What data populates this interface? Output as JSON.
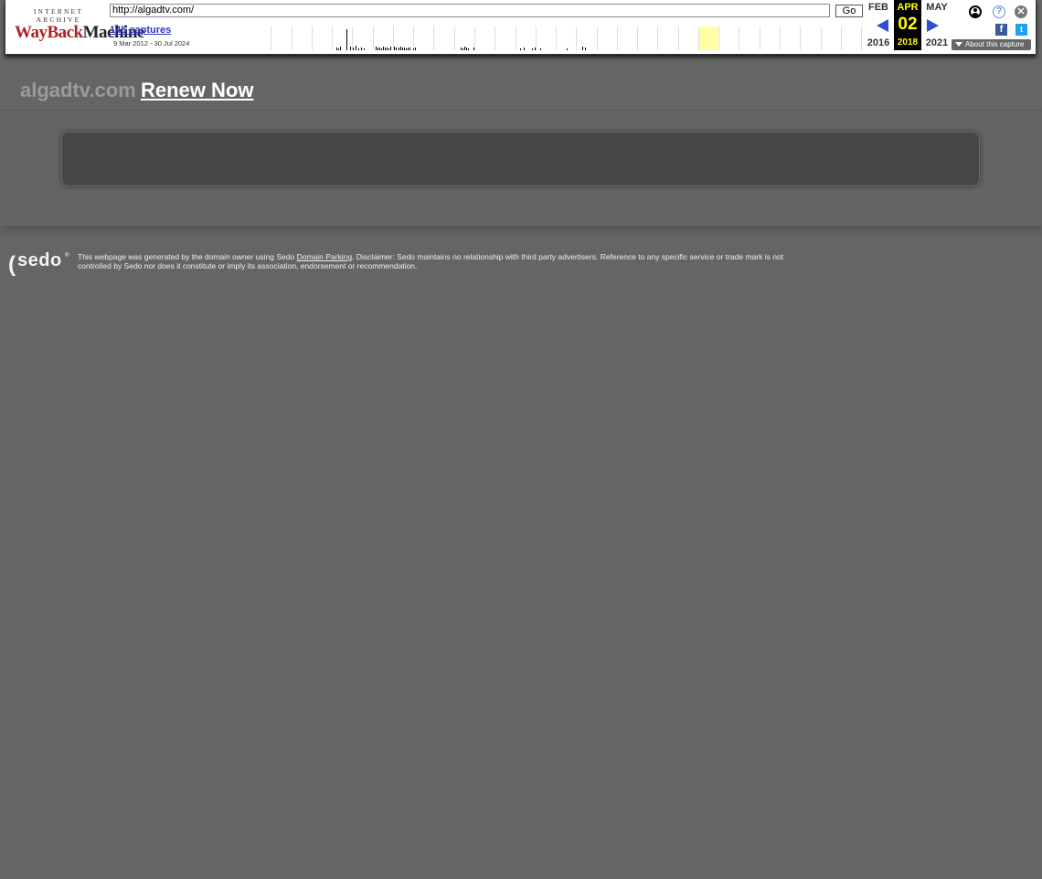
{
  "wayback": {
    "logo_top": "INTERNET ARCHIVE",
    "logo_wayback": "WayBack",
    "logo_machine": "Machine",
    "url_value": "http://algadtv.com/",
    "go_label": "Go",
    "captures_label": "145 captures",
    "range_label": "9 Mar 2012 - 30 Jul 2024",
    "prev": {
      "month": "FEB",
      "year": "2016"
    },
    "current": {
      "month": "APR",
      "day": "02",
      "year": "2018"
    },
    "next": {
      "month": "MAY",
      "year": "2021"
    },
    "help_glyph": "?",
    "close_glyph": "✕",
    "facebook_glyph": "f",
    "twitter_glyph": "t",
    "about_label": "About this capture",
    "colors": {
      "calendar_highlight": "#ffff00",
      "arrow": "#2e4dd0",
      "logo_red": "#b12026"
    }
  },
  "page": {
    "domain": "algadtv.com",
    "renew_label": "Renew Now"
  },
  "footer": {
    "logo_text": "sedo",
    "logo_paren": "(",
    "logo_reg": "®",
    "text_before": "This webpage was generated by the domain owner using Sedo ",
    "link_label": "Domain Parking",
    "text_after": ". Disclaimer: Sedo maintains no relationship with third party advertisers. Reference to any specific service or trade mark is not controlled by Sedo nor does it constitute or imply its association, endorsement or recommendation."
  }
}
